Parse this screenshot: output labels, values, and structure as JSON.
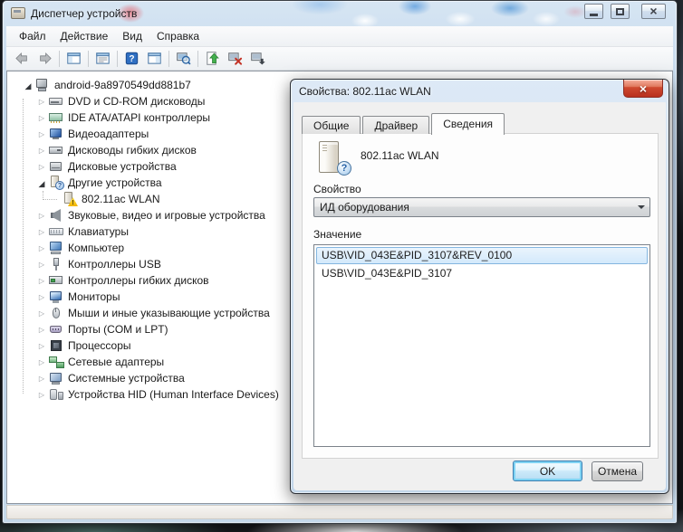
{
  "window": {
    "title": "Диспетчер устройств",
    "app_icon": "device-manager-icon",
    "caption_buttons": [
      "minimize",
      "maximize",
      "close"
    ]
  },
  "menu": {
    "items": [
      {
        "label": "Файл"
      },
      {
        "label": "Действие"
      },
      {
        "label": "Вид"
      },
      {
        "label": "Справка"
      }
    ]
  },
  "toolbar": {
    "buttons": [
      "back",
      "forward",
      "|",
      "console-tree",
      "|",
      "properties",
      "|",
      "help",
      "action-pane",
      "|",
      "scan-hardware-changes",
      "|",
      "update-driver",
      "uninstall-device",
      "disable-device"
    ]
  },
  "tree": {
    "items": [
      {
        "label": "android-9a8970549dd881b7",
        "icon": "workstation",
        "level": 0,
        "expander": "expanded"
      },
      {
        "label": "DVD и CD-ROM дисководы",
        "icon": "dvd-drive",
        "level": 1,
        "expander": "collapsed"
      },
      {
        "label": "IDE ATA/ATAPI контроллеры",
        "icon": "ide-controller",
        "level": 1,
        "expander": "collapsed"
      },
      {
        "label": "Видеоадаптеры",
        "icon": "video-adapter",
        "level": 1,
        "expander": "collapsed"
      },
      {
        "label": "Дисководы гибких дисков",
        "icon": "floppy-drive",
        "level": 1,
        "expander": "collapsed"
      },
      {
        "label": "Дисковые устройства",
        "icon": "disk-drive",
        "level": 1,
        "expander": "collapsed"
      },
      {
        "label": "Другие устройства",
        "icon": "unknown-device",
        "level": 1,
        "expander": "expanded"
      },
      {
        "label": "802.11ac WLAN",
        "icon": "unknown-warning",
        "level": 2,
        "expander": "none"
      },
      {
        "label": "Звуковые, видео и игровые устройства",
        "icon": "sound-device",
        "level": 1,
        "expander": "collapsed"
      },
      {
        "label": "Клавиатуры",
        "icon": "keyboard",
        "level": 1,
        "expander": "collapsed"
      },
      {
        "label": "Компьютер",
        "icon": "computer",
        "level": 1,
        "expander": "collapsed"
      },
      {
        "label": "Контроллеры USB",
        "icon": "usb-controller",
        "level": 1,
        "expander": "collapsed"
      },
      {
        "label": "Контроллеры гибких дисков",
        "icon": "floppy-controller",
        "level": 1,
        "expander": "collapsed"
      },
      {
        "label": "Мониторы",
        "icon": "monitor",
        "level": 1,
        "expander": "collapsed"
      },
      {
        "label": "Мыши и иные указывающие устройства",
        "icon": "mouse",
        "level": 1,
        "expander": "collapsed"
      },
      {
        "label": "Порты (COM и LPT)",
        "icon": "ports",
        "level": 1,
        "expander": "collapsed"
      },
      {
        "label": "Процессоры",
        "icon": "processor",
        "level": 1,
        "expander": "collapsed"
      },
      {
        "label": "Сетевые адаптеры",
        "icon": "network-adapter",
        "level": 1,
        "expander": "collapsed"
      },
      {
        "label": "Системные устройства",
        "icon": "system-device",
        "level": 1,
        "expander": "collapsed"
      },
      {
        "label": "Устройства HID (Human Interface Devices)",
        "icon": "hid-device",
        "level": 1,
        "expander": "collapsed"
      }
    ]
  },
  "status": {
    "text": ""
  },
  "dialog": {
    "title": "Свойства: 802.11ac WLAN",
    "tabs": [
      {
        "label": "Общие",
        "active": false
      },
      {
        "label": "Драйвер",
        "active": false
      },
      {
        "label": "Сведения",
        "active": true
      }
    ],
    "device_name": "802.11ac WLAN",
    "property_label": "Свойство",
    "property_value": "ИД оборудования",
    "value_label": "Значение",
    "values": [
      {
        "text": "USB\\VID_043E&PID_3107&REV_0100",
        "selected": true
      },
      {
        "text": "USB\\VID_043E&PID_3107",
        "selected": false
      }
    ],
    "buttons": {
      "ok": "OK",
      "cancel": "Отмена"
    }
  },
  "colors": {
    "titlebar_glass": "#bcd6ec",
    "dialog_frame": "#cddcec",
    "selection_fill": "#dcecfb",
    "selection_border": "#84b6e0",
    "close_button_red": "#cf4a30",
    "warning_yellow": "#f0b400",
    "unknown_badge_blue": "#2f6fbe"
  }
}
